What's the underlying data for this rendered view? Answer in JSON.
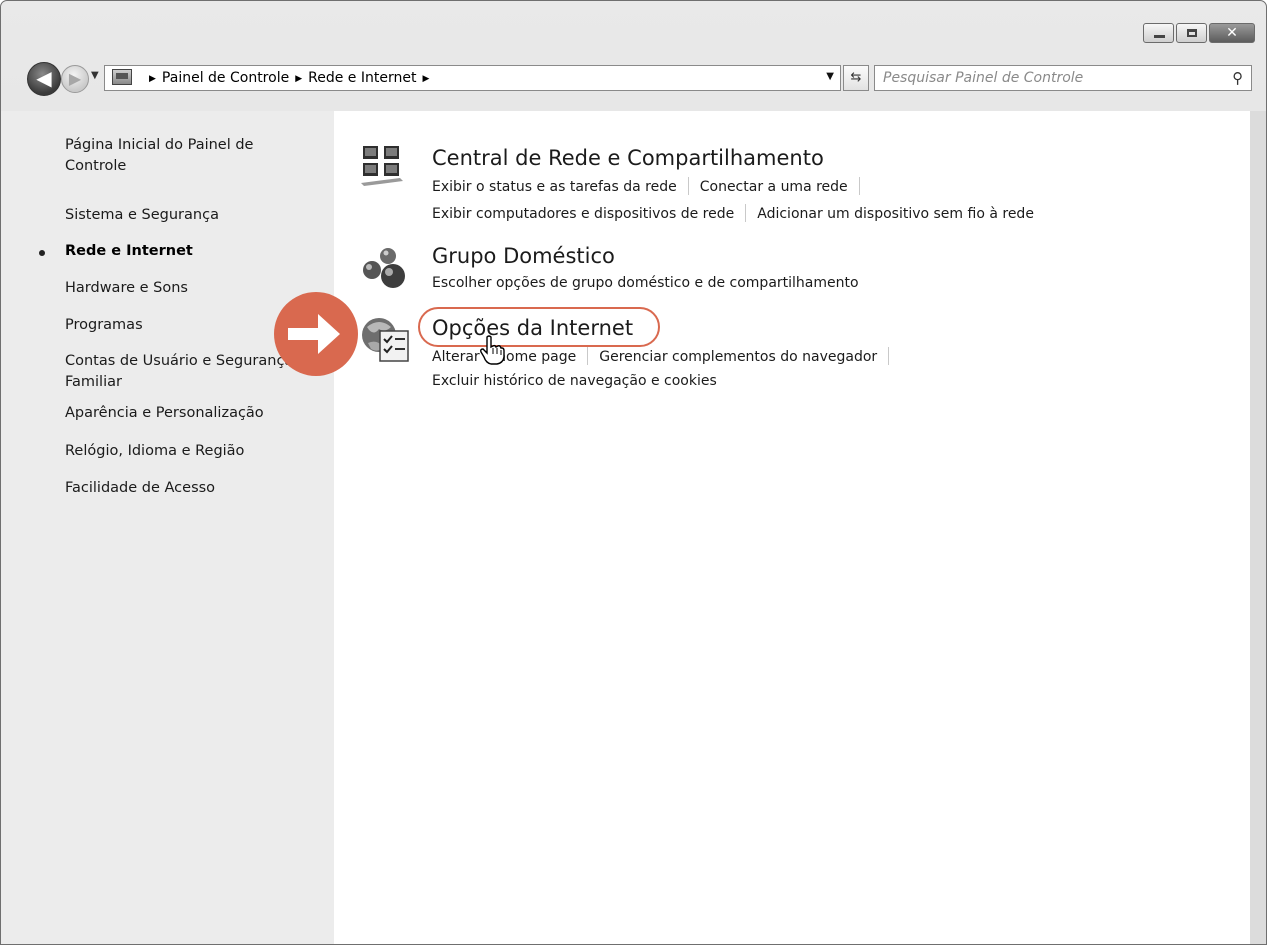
{
  "window": {
    "minimize_icon": "minimize-icon",
    "maximize_icon": "maximize-icon",
    "close_glyph": "✕"
  },
  "nav": {
    "back_glyph": "◀",
    "forward_glyph": "▶",
    "recent_glyph": "▼",
    "breadcrumb": [
      "Painel de Controle",
      "Rede e Internet"
    ],
    "address_dropdown_glyph": "▼",
    "refresh_glyph": "⇆",
    "search_placeholder": "Pesquisar Painel de Controle",
    "search_glyph": "⚲"
  },
  "sidebar": {
    "items": [
      "Página Inicial do Painel de Controle",
      "Sistema e Segurança",
      "Rede e Internet",
      "Hardware e Sons",
      "Programas",
      "Contas de Usuário e Segurança Familiar",
      "Aparência e Personalização",
      "Relógio, Idioma e Região",
      "Facilidade de Acesso"
    ],
    "current_index": 2
  },
  "categories": [
    {
      "title": "Central de Rede e Compartilhamento",
      "icon": "network-center-icon",
      "task_lines": [
        [
          "Exibir o status e as tarefas da rede",
          "Conectar a uma rede"
        ],
        [
          "Exibir computadores e dispositivos de rede",
          "Adicionar um dispositivo sem fio à rede"
        ]
      ]
    },
    {
      "title": "Grupo Doméstico",
      "icon": "homegroup-icon",
      "task_lines": [
        [
          "Escolher opções de grupo doméstico e de compartilhamento"
        ]
      ]
    },
    {
      "title": "Opções da Internet",
      "icon": "internet-options-icon",
      "task_lines": [
        [
          "Alterar a home page",
          "Gerenciar complementos do navegador"
        ],
        [
          "Excluir histórico de navegação e cookies"
        ]
      ]
    }
  ],
  "colors": {
    "callout": "#d9694f",
    "sidebar_bg": "#ececec",
    "text": "#1b1b1b"
  }
}
